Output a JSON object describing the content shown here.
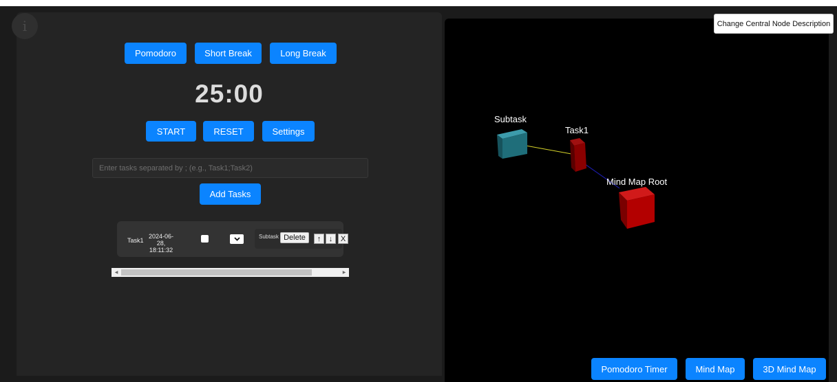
{
  "timer_modes": [
    "Pomodoro",
    "Short Break",
    "Long Break"
  ],
  "timer": {
    "display": "25:00"
  },
  "controls": {
    "start": "START",
    "reset": "RESET",
    "settings": "Settings"
  },
  "task_entry": {
    "placeholder": "Enter tasks separated by ; (e.g., Task1;Task2)",
    "add_label": "Add Tasks"
  },
  "task": {
    "name": "Task1",
    "date": "2024-06-28,",
    "time": "18:11:32",
    "subtask": "Subtask",
    "delete_label": "Delete",
    "up": "↑",
    "down": "↓",
    "remove": "X"
  },
  "info_icon": "i",
  "mindmap": {
    "change_label": "Change Central Node Description",
    "nodes": [
      {
        "label": "Subtask",
        "color": "#1f6e7a"
      },
      {
        "label": "Task1",
        "color": "#8a0000"
      },
      {
        "label": "Mind Map Root",
        "color": "#b30000"
      }
    ],
    "link_colors": [
      "#d6d32a",
      "#1a1aa0"
    ]
  },
  "view_nav": [
    "Pomodoro Timer",
    "Mind Map",
    "3D Mind Map"
  ],
  "colors": {
    "accent": "#0b84ff",
    "panel": "#242424",
    "background": "#1b1b1b",
    "scene": "#000000"
  }
}
